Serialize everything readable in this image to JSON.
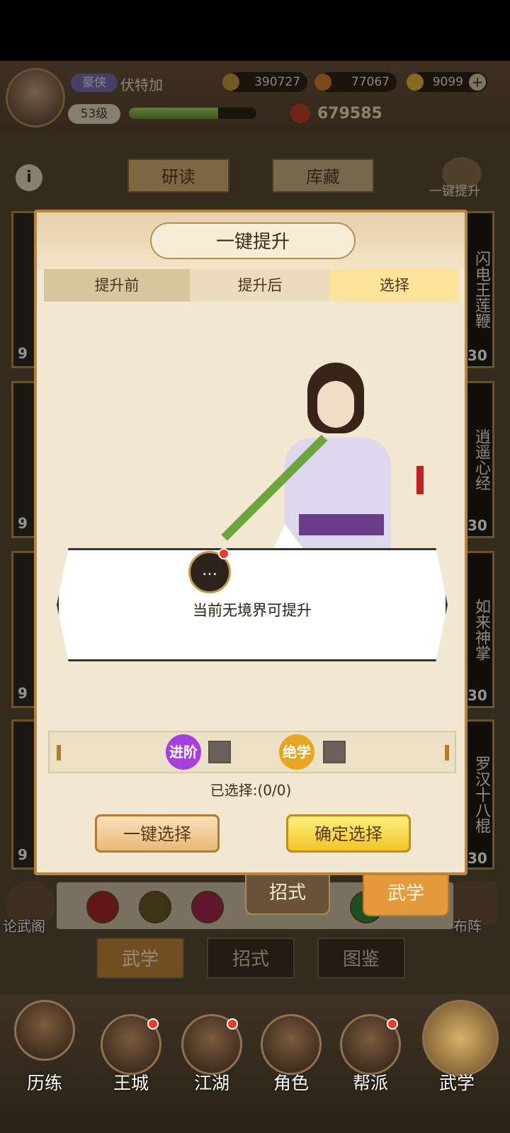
{
  "player": {
    "title_badge": "豪侠",
    "name": "伏特加",
    "level": "53级",
    "xp_fraction": 0.7,
    "power": "679585"
  },
  "resources": [
    {
      "icon": "copper-coin-icon",
      "value": "390727",
      "color": "#c99a3b"
    },
    {
      "icon": "medal-icon",
      "value": "77067",
      "color": "#d87a2a"
    },
    {
      "icon": "gold-ingot-icon",
      "value": "9099",
      "color": "#e5b93a"
    }
  ],
  "top_tabs": [
    "研读",
    "库藏"
  ],
  "one_key_upgrade_label": "一键提升",
  "side_list": [
    {
      "name": "闪电王莲鞭",
      "level": "30"
    },
    {
      "name": "逍遥心经",
      "level": "30"
    },
    {
      "name": "如来神掌",
      "level": "30"
    },
    {
      "name": "罗汉十八棍",
      "level": "30"
    }
  ],
  "left_side_numbers": [
    "9",
    "9",
    "9",
    "9"
  ],
  "modal": {
    "title": "一键提升",
    "steps": [
      "提升前",
      "提升后",
      "选择"
    ],
    "active_step": 2,
    "message": "当前无境界可提升",
    "message_icon": "speech-bubble-icon",
    "filters": [
      {
        "label": "进阶",
        "color": "#a63ee0"
      },
      {
        "label": "绝学",
        "color": "#e8a520"
      }
    ],
    "selected_count": "已选择:(0/0)",
    "btn_auto_select": "一键选择",
    "btn_confirm": "确定选择"
  },
  "sub_tabs": [
    "招式",
    "武学"
  ],
  "lunwu_label": "论武阁",
  "buzhen_label": "布阵",
  "bottom_tabs": [
    "武学",
    "招式",
    "图鉴"
  ],
  "nav": [
    {
      "label": "历练",
      "badge": false
    },
    {
      "label": "王城",
      "badge": true
    },
    {
      "label": "江湖",
      "badge": true
    },
    {
      "label": "角色",
      "badge": false
    },
    {
      "label": "帮派",
      "badge": true
    },
    {
      "label": "武学",
      "badge": false
    }
  ]
}
